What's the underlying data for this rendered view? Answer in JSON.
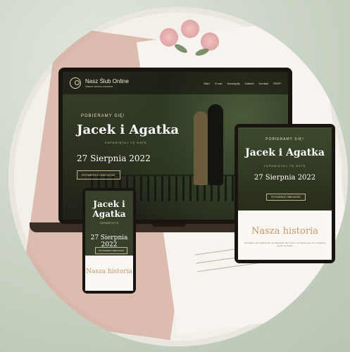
{
  "brand": {
    "title": "Nasz Ślub Online",
    "subtitle": "Nasza strona weselna"
  },
  "nav": [
    "Start",
    "O nas",
    "Szczegóły",
    "Galeria",
    "Kontakt",
    "RSVP"
  ],
  "hero": {
    "eyebrow": "POBIERAMY SIĘ!",
    "names": "Jacek i Agatka",
    "save_date": "ZAPAMIĘTAJ TĘ DATĘ",
    "date": "27 Sierpnia 2022",
    "button": "POTWIERDŹ OBECNOŚĆ"
  },
  "tablet": {
    "eyebrow": "POBIERAMY SIĘ!",
    "names": "Jacek i Agatka",
    "save_date": "ZAPAMIĘTAJ TĘ DATĘ",
    "date": "27 Sierpnia 2022",
    "button": "POTWIERDŹ OBECNOŚĆ",
    "story_title": "Nasza historia",
    "story_text": "Poznaliśmy się w 2015 roku na wakacjach nad morzem. Od tamtej pory nie rozstajemy się ani na chwilę."
  },
  "phone": {
    "names": "Jacek i Agatka",
    "save_date": "ZAPAMIĘTAJ TĘ",
    "date": "27 Sierpnia 2022",
    "button": "POTWIERDŹ OBECNOŚĆ",
    "story_title": "Nasza historia"
  },
  "colors": {
    "accent": "#c8946c",
    "dark": "#1a1410",
    "background": "#c9d2c4"
  }
}
